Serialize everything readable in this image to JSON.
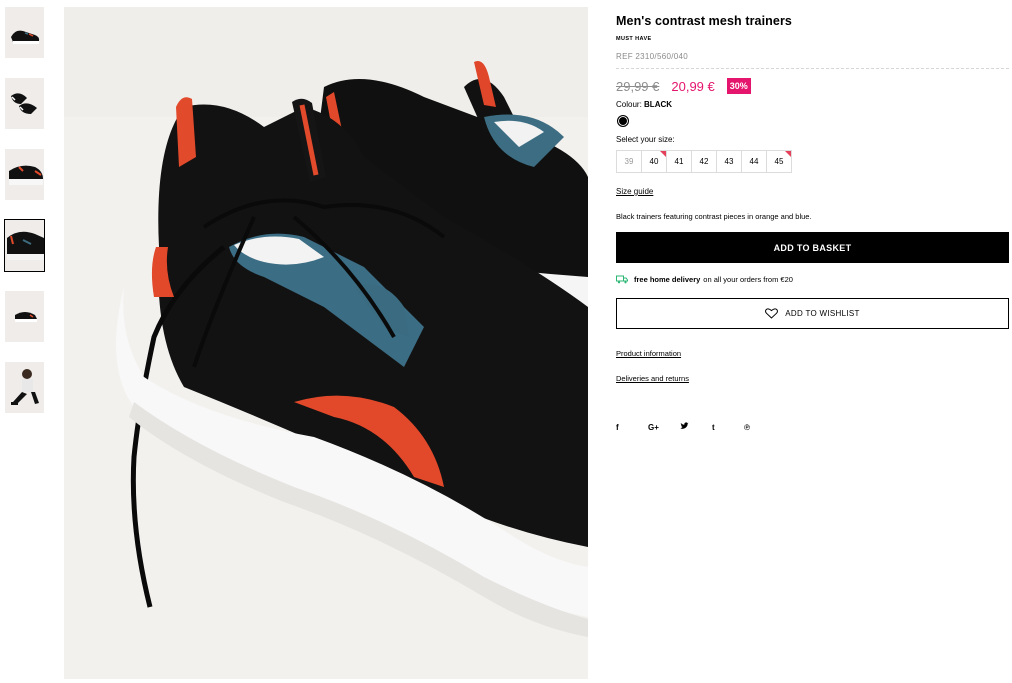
{
  "thumbnails": [
    {
      "name": "thumb-1",
      "active": false
    },
    {
      "name": "thumb-2",
      "active": false
    },
    {
      "name": "thumb-3",
      "active": false
    },
    {
      "name": "thumb-4",
      "active": true
    },
    {
      "name": "thumb-5",
      "active": false
    },
    {
      "name": "thumb-6",
      "active": false
    }
  ],
  "product": {
    "title": "Men's contrast mesh trainers",
    "tag": "MUST HAVE",
    "ref": "REF 2310/560/040",
    "old_price": "29,99 €",
    "new_price": "20,99 €",
    "discount": "30%",
    "colour_label": "Colour:",
    "colour_value": "BLACK",
    "size_label": "Select your size:",
    "sizes": [
      {
        "label": "39",
        "available": false,
        "low_stock": false
      },
      {
        "label": "40",
        "available": true,
        "low_stock": true
      },
      {
        "label": "41",
        "available": true,
        "low_stock": false
      },
      {
        "label": "42",
        "available": true,
        "low_stock": false
      },
      {
        "label": "43",
        "available": true,
        "low_stock": false
      },
      {
        "label": "44",
        "available": true,
        "low_stock": false
      },
      {
        "label": "45",
        "available": true,
        "low_stock": true
      }
    ],
    "size_guide": "Size guide",
    "description": "Black trainers featuring contrast pieces in orange and blue.",
    "add_to_basket": "ADD TO BASKET",
    "delivery_bold": "free home delivery",
    "delivery_rest": "on all your orders from €20",
    "add_to_wishlist": "ADD TO WISHLIST",
    "product_information": "Product information",
    "deliveries_and_returns": "Deliveries and returns"
  },
  "social": {
    "facebook": "f",
    "google_plus": "G+",
    "twitter": "🐦",
    "tumblr": "t",
    "pinterest": "℗"
  },
  "colors": {
    "accent_pink": "#e5156e",
    "low_stock_marker": "#e5415a",
    "delivery_icon": "#2bb673"
  }
}
